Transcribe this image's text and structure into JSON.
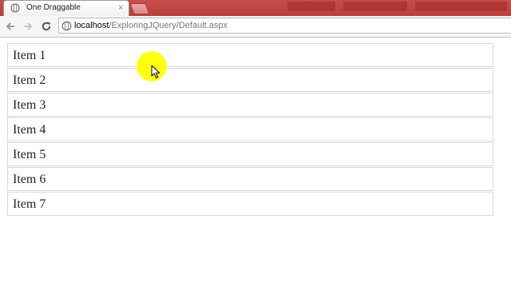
{
  "browser": {
    "tab": {
      "title": "One Draggable",
      "close_glyph": "×"
    },
    "address": {
      "host": "localhost",
      "path": "/ExploringJQuery/Default.aspx"
    },
    "icons": {
      "back": "back-arrow-icon",
      "forward": "forward-arrow-icon",
      "reload": "reload-icon",
      "page": "page-globe-icon"
    }
  },
  "page": {
    "items": [
      "Item 1",
      "Item 2",
      "Item 3",
      "Item 4",
      "Item 5",
      "Item 6",
      "Item 7"
    ]
  },
  "colors": {
    "tabstrip": "#c94e4b",
    "item_border": "#d9d9d9",
    "cursor_highlight": "#ffff00"
  }
}
